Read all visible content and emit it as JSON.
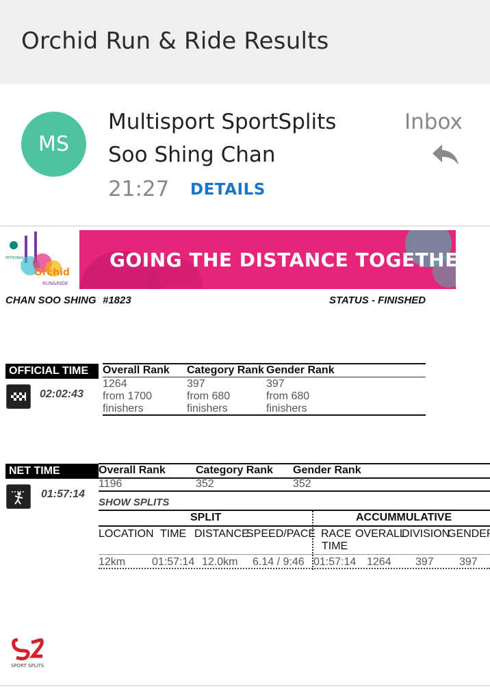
{
  "app": {
    "title": "Orchid Run & Ride Results"
  },
  "email": {
    "avatar_initials": "MS",
    "avatar_color": "#4ec3a0",
    "sender": "Multisport SportSplits",
    "recipient": "Soo Shing Chan",
    "time": "21:27",
    "details_label": "DETAILS",
    "folder": "Inbox"
  },
  "banner": {
    "tagline": "GOING THE DISTANCE TOGETHER",
    "accent": "#e5247a",
    "event_logo": "Orchid RUN & RIDE",
    "sponsor": "PETRONAS"
  },
  "participant": {
    "name": "CHAN SOO SHING",
    "bib": "#1823",
    "status": "STATUS - FINISHED"
  },
  "official": {
    "label": "OFFICIAL TIME",
    "time": "02:02:43",
    "headers": [
      "Overall Rank",
      "Category Rank",
      "Gender Rank"
    ],
    "ranks": [
      {
        "value": "1264",
        "from": "from 1700",
        "unit": "finishers"
      },
      {
        "value": "397",
        "from": "from 680",
        "unit": "finishers"
      },
      {
        "value": "397",
        "from": "from 680",
        "unit": "finishers"
      }
    ]
  },
  "net": {
    "label": "NET TIME",
    "time": "01:57:14",
    "headers": [
      "Overall Rank",
      "Category Rank",
      "Gender Rank"
    ],
    "ranks": [
      "1196",
      "352",
      "352"
    ],
    "show_splits": "SHOW SPLITS",
    "split_header": "SPLIT",
    "accum_header": "ACCUMMULATIVE",
    "columns": [
      "LOCATION",
      "TIME",
      "DISTANCE",
      "SPEED/PACE",
      "RACE",
      "TIME",
      "OVERALL",
      "DIVISION",
      "GENDER"
    ],
    "row": [
      "12km",
      "01:57:14",
      "12.0km",
      "6.14 / 9:46",
      "01:57:14",
      "1264",
      "397",
      "397"
    ]
  },
  "footer": {
    "logo_text": "SPORT SPLITS"
  }
}
